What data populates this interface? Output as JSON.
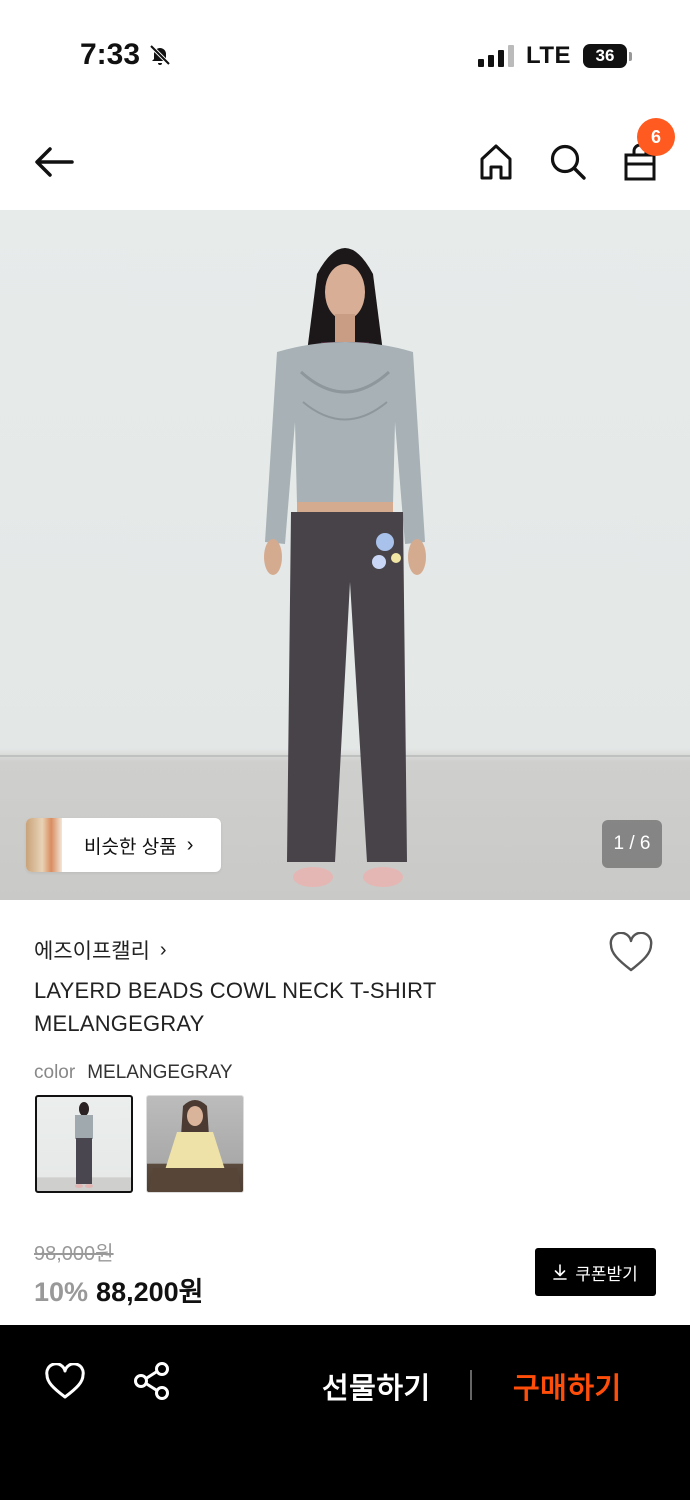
{
  "status_bar": {
    "time": "7:33",
    "network": "LTE",
    "battery": "36",
    "icons": [
      "bell-muted-icon",
      "signal-icon",
      "battery-icon"
    ]
  },
  "nav": {
    "icons": [
      "back-arrow-icon",
      "home-icon",
      "search-icon",
      "shopping-bag-icon"
    ],
    "cart_count": "6",
    "accent_color": "#ff5a1f"
  },
  "hero": {
    "similar_products_label": "비슷한 상품",
    "page_indicator": "1 / 6"
  },
  "product": {
    "brand": "에즈이프캘리",
    "title": "LAYERD BEADS COWL NECK T-SHIRT MELANGEGRAY",
    "color_label": "color",
    "color_value": "MELANGEGRAY",
    "original_price": "98,000원",
    "discount": "10%",
    "price": "88,200원",
    "coupon_label": "쿠폰받기"
  },
  "bottom_bar": {
    "gift_label": "선물하기",
    "buy_label": "구매하기",
    "buy_color": "#ff4d0a",
    "icons": [
      "heart-icon",
      "share-icon"
    ]
  }
}
